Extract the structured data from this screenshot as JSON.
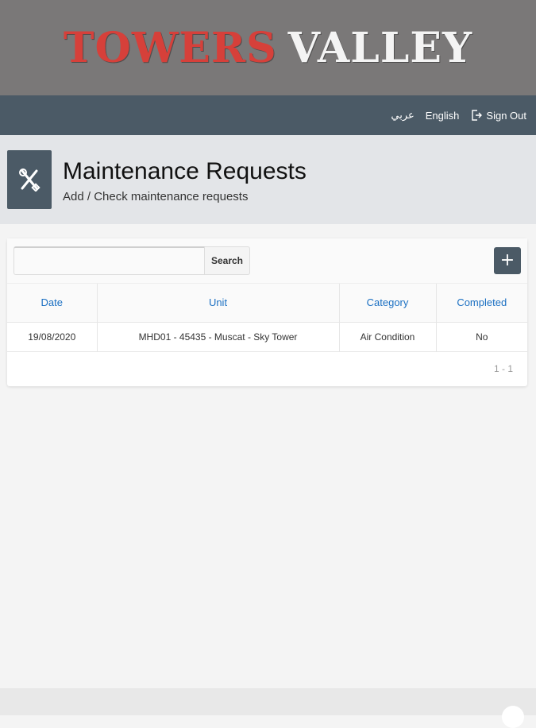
{
  "brand": {
    "word1": "TOWERS",
    "word2": "VALLEY",
    "word1_color": "#d6403a",
    "word2_color": "#f4f4f4"
  },
  "nav": {
    "arabic": "عربي",
    "english": "English",
    "signout": "Sign Out",
    "signout_icon": "sign-out-icon"
  },
  "header": {
    "icon": "tools-icon",
    "title": "Maintenance Requests",
    "subtitle": "Add / Check maintenance requests"
  },
  "toolbar": {
    "search_value": "",
    "search_placeholder": "",
    "search_label": "Search",
    "add_label": "+"
  },
  "table": {
    "columns": [
      "Date",
      "Unit",
      "Category",
      "Completed"
    ],
    "rows": [
      [
        "19/08/2020",
        "MHD01 - 45435 - Muscat - Sky Tower",
        "Air Condition",
        "No"
      ]
    ]
  },
  "pager": {
    "range": "1 - 1"
  },
  "colors": {
    "accent": "#4b5a66",
    "link": "#1a6fc2"
  }
}
